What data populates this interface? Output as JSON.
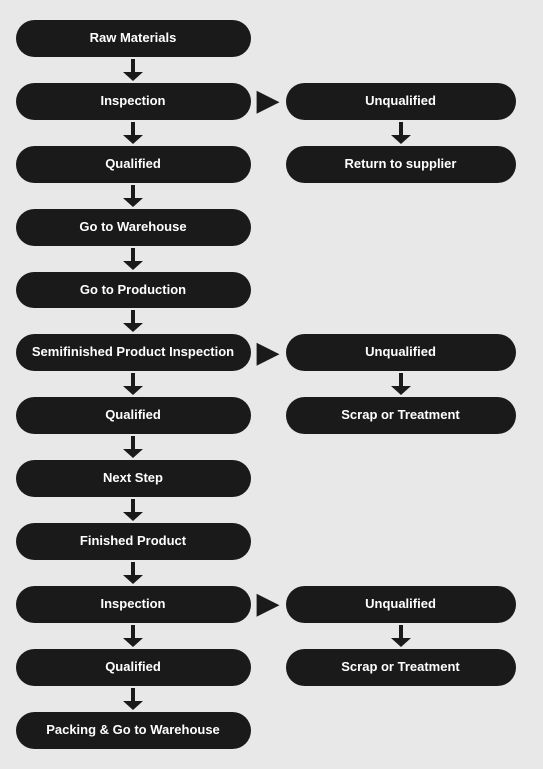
{
  "nodes": {
    "raw_materials": "Raw Materials",
    "inspection1": "Inspection",
    "qualified1": "Qualified",
    "go_to_warehouse": "Go to Warehouse",
    "go_to_production": "Go to Production",
    "semifinished": "Semifinished Product Inspection",
    "qualified2": "Qualified",
    "next_step": "Next Step",
    "finished_product": "Finished Product",
    "inspection2": "Inspection",
    "qualified3": "Qualified",
    "packing": "Packing & Go to Warehouse",
    "unqualified1": "Unqualified",
    "return_supplier": "Return to supplier",
    "unqualified2": "Unqualified",
    "scrap1": "Scrap or Treatment",
    "unqualified3": "Unqualified",
    "scrap2": "Scrap or Treatment"
  }
}
